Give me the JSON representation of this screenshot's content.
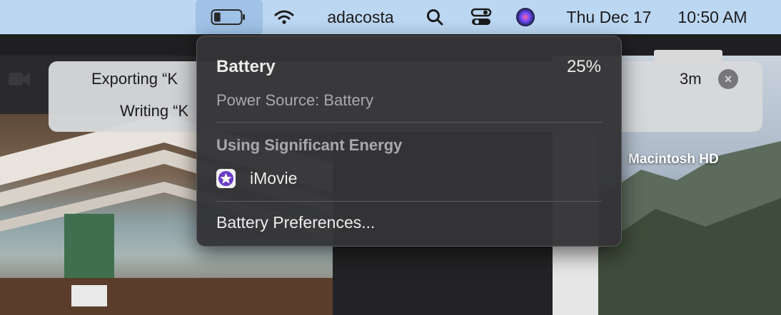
{
  "menubar": {
    "username": "adacosta",
    "date": "Thu Dec 17",
    "time": "10:50 AM",
    "icons": [
      "battery-icon",
      "wifi-icon",
      "search-icon",
      "control-center-icon",
      "siri-icon"
    ]
  },
  "battery_menu": {
    "title": "Battery",
    "percent": "25%",
    "level": 0.25,
    "power_source": "Power Source: Battery",
    "section_title": "Using Significant Energy",
    "apps": [
      {
        "name": "iMovie",
        "icon": "imovie-icon"
      }
    ],
    "preferences": "Battery Preferences..."
  },
  "notification": {
    "line1": "Exporting “K",
    "line2": "Writing “K",
    "time": "3m"
  },
  "desktop": {
    "drive_label": "Macintosh HD"
  },
  "colors": {
    "menubar": "#bcd7f2",
    "menubar_highlight": "#9fc2e6",
    "menu_bg": "#343437",
    "imovie_purple": "#6b3cc9"
  }
}
